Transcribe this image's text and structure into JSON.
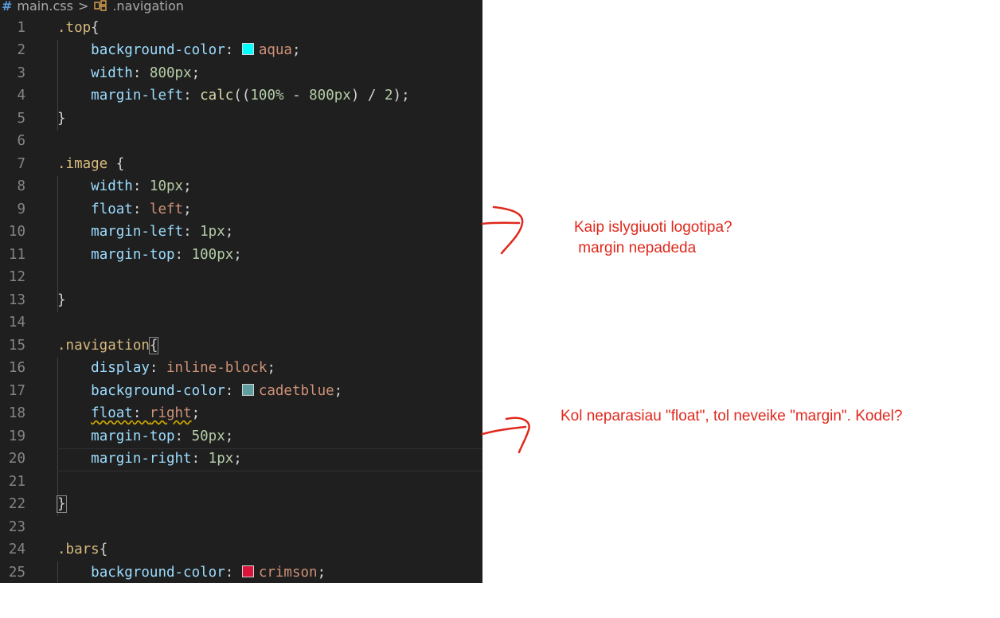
{
  "breadcrumb": {
    "file": "main.css",
    "separator": ">",
    "symbol": ".navigation"
  },
  "code_lines": [
    {
      "n": "1",
      "parts": [
        [
          "sel",
          ".top"
        ],
        [
          "brace",
          "{"
        ]
      ]
    },
    {
      "n": "2",
      "parts": [
        [
          "ind",
          "    "
        ],
        [
          "prop",
          "background-color"
        ],
        [
          "punct",
          ": "
        ],
        [
          "swatch",
          "#00ffff"
        ],
        [
          "val",
          "aqua"
        ],
        [
          "punct",
          ";"
        ]
      ]
    },
    {
      "n": "3",
      "parts": [
        [
          "ind",
          "    "
        ],
        [
          "prop",
          "width"
        ],
        [
          "punct",
          ": "
        ],
        [
          "num-v",
          "800px"
        ],
        [
          "punct",
          ";"
        ]
      ]
    },
    {
      "n": "4",
      "parts": [
        [
          "ind",
          "    "
        ],
        [
          "prop",
          "margin-left"
        ],
        [
          "punct",
          ": "
        ],
        [
          "fn",
          "calc"
        ],
        [
          "punct",
          "(("
        ],
        [
          "num-v",
          "100%"
        ],
        [
          "punct",
          " - "
        ],
        [
          "num-v",
          "800px"
        ],
        [
          "punct",
          ") / "
        ],
        [
          "num-v",
          "2"
        ],
        [
          "punct",
          ");"
        ]
      ]
    },
    {
      "n": "5",
      "parts": [
        [
          "brace",
          "}"
        ]
      ]
    },
    {
      "n": "6",
      "parts": []
    },
    {
      "n": "7",
      "parts": [
        [
          "sel",
          ".image"
        ],
        [
          "brace",
          " {"
        ]
      ]
    },
    {
      "n": "8",
      "parts": [
        [
          "ind",
          "    "
        ],
        [
          "prop",
          "width"
        ],
        [
          "punct",
          ": "
        ],
        [
          "num-v",
          "10px"
        ],
        [
          "punct",
          ";"
        ]
      ]
    },
    {
      "n": "9",
      "parts": [
        [
          "ind",
          "    "
        ],
        [
          "prop",
          "float"
        ],
        [
          "punct",
          ": "
        ],
        [
          "val",
          "left"
        ],
        [
          "punct",
          ";"
        ]
      ]
    },
    {
      "n": "10",
      "parts": [
        [
          "ind",
          "    "
        ],
        [
          "prop",
          "margin-left"
        ],
        [
          "punct",
          ": "
        ],
        [
          "num-v",
          "1px"
        ],
        [
          "punct",
          ";"
        ]
      ]
    },
    {
      "n": "11",
      "parts": [
        [
          "ind",
          "    "
        ],
        [
          "prop",
          "margin-top"
        ],
        [
          "punct",
          ": "
        ],
        [
          "num-v",
          "100px"
        ],
        [
          "punct",
          ";"
        ]
      ]
    },
    {
      "n": "12",
      "parts": []
    },
    {
      "n": "13",
      "parts": [
        [
          "brace",
          "}"
        ]
      ]
    },
    {
      "n": "14",
      "parts": []
    },
    {
      "n": "15",
      "parts": [
        [
          "sel",
          ".navigation"
        ],
        [
          "brace-hl",
          "{"
        ]
      ]
    },
    {
      "n": "16",
      "parts": [
        [
          "ind",
          "    "
        ],
        [
          "prop",
          "display"
        ],
        [
          "punct",
          ": "
        ],
        [
          "val",
          "inline-block"
        ],
        [
          "punct",
          ";"
        ]
      ]
    },
    {
      "n": "17",
      "parts": [
        [
          "ind",
          "    "
        ],
        [
          "prop",
          "background-color"
        ],
        [
          "punct",
          ": "
        ],
        [
          "swatch",
          "#5f9ea0"
        ],
        [
          "val",
          "cadetblue"
        ],
        [
          "punct",
          ";"
        ]
      ]
    },
    {
      "n": "18",
      "parts": [
        [
          "ind",
          "    "
        ],
        [
          "prop-sq",
          "float"
        ],
        [
          "punct-sq",
          ": "
        ],
        [
          "val-sq",
          "right"
        ],
        [
          "punct",
          ";"
        ]
      ]
    },
    {
      "n": "19",
      "parts": [
        [
          "ind",
          "    "
        ],
        [
          "prop",
          "margin-top"
        ],
        [
          "punct",
          ": "
        ],
        [
          "num-v",
          "50px"
        ],
        [
          "punct",
          ";"
        ]
      ]
    },
    {
      "n": "20",
      "parts": [
        [
          "ind",
          "    "
        ],
        [
          "prop",
          "margin-right"
        ],
        [
          "punct",
          ": "
        ],
        [
          "num-v",
          "1px"
        ],
        [
          "punct",
          ";"
        ]
      ]
    },
    {
      "n": "21",
      "parts": []
    },
    {
      "n": "22",
      "parts": [
        [
          "brace-hl",
          "}"
        ]
      ]
    },
    {
      "n": "23",
      "parts": []
    },
    {
      "n": "24",
      "parts": [
        [
          "sel",
          ".bars"
        ],
        [
          "brace",
          "{"
        ]
      ]
    },
    {
      "n": "25",
      "parts": [
        [
          "ind",
          "    "
        ],
        [
          "prop",
          "background-color"
        ],
        [
          "punct",
          ": "
        ],
        [
          "swatch",
          "#dc143c"
        ],
        [
          "val",
          "crimson"
        ],
        [
          "punct",
          ";"
        ]
      ]
    }
  ],
  "annotations": {
    "note1": "Kaip islygiuoti logotipa?\n margin nepadeda",
    "note2": "Kol neparasiau \"float\", tol neveike \"margin\". Kodel?"
  },
  "colors": {
    "annotation": "#e0281c",
    "editor_bg": "#1f1f1f"
  }
}
